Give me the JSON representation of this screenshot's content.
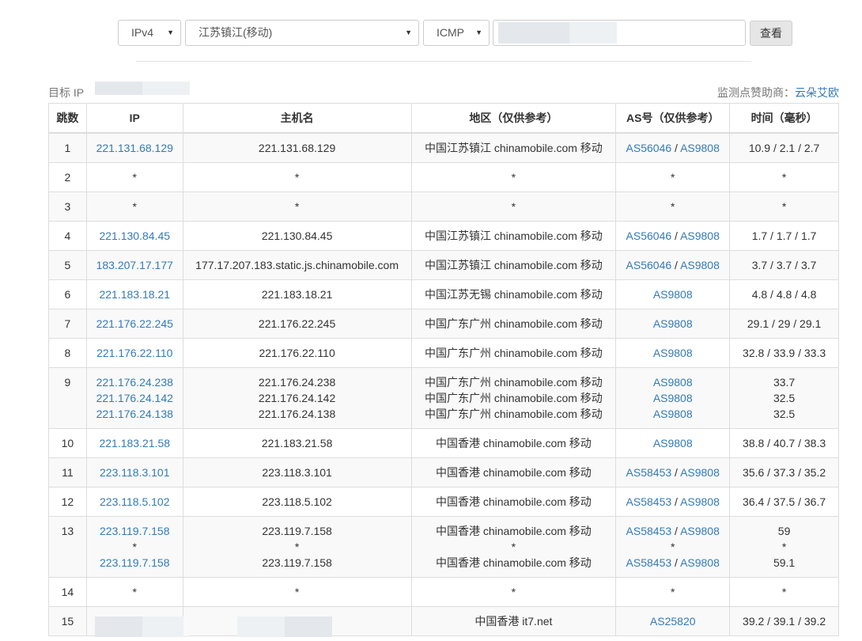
{
  "form": {
    "protocol": {
      "selected": "IPv4"
    },
    "location": {
      "selected": "江苏镇江(移动)"
    },
    "method": {
      "selected": "ICMP"
    },
    "target": {
      "value": ""
    },
    "submit_label": "查看"
  },
  "target_label": "目标 IP",
  "sponsor": {
    "prefix": "监测点赞助商：",
    "name": "云朵艾欧"
  },
  "table": {
    "headers": [
      "跳数",
      "IP",
      "主机名",
      "地区（仅供参考）",
      "AS号（仅供参考）",
      "时间（毫秒）"
    ],
    "rows": [
      {
        "hop": "1",
        "ips": [
          "221.131.68.129"
        ],
        "hosts": [
          "221.131.68.129"
        ],
        "regions": [
          "中国江苏镇江 chinamobile.com 移动"
        ],
        "as": [
          [
            "AS56046",
            "AS9808"
          ]
        ],
        "times": [
          "10.9 / 2.1 / 2.7"
        ]
      },
      {
        "hop": "2",
        "ips": [
          "*"
        ],
        "hosts": [
          "*"
        ],
        "regions": [
          "*"
        ],
        "as": [
          [
            "*"
          ]
        ],
        "times": [
          "*"
        ]
      },
      {
        "hop": "3",
        "ips": [
          "*"
        ],
        "hosts": [
          "*"
        ],
        "regions": [
          "*"
        ],
        "as": [
          [
            "*"
          ]
        ],
        "times": [
          "*"
        ]
      },
      {
        "hop": "4",
        "ips": [
          "221.130.84.45"
        ],
        "hosts": [
          "221.130.84.45"
        ],
        "regions": [
          "中国江苏镇江 chinamobile.com 移动"
        ],
        "as": [
          [
            "AS56046",
            "AS9808"
          ]
        ],
        "times": [
          "1.7 / 1.7 / 1.7"
        ]
      },
      {
        "hop": "5",
        "ips": [
          "183.207.17.177"
        ],
        "hosts": [
          "177.17.207.183.static.js.chinamobile.com"
        ],
        "regions": [
          "中国江苏镇江 chinamobile.com 移动"
        ],
        "as": [
          [
            "AS56046",
            "AS9808"
          ]
        ],
        "times": [
          "3.7 / 3.7 / 3.7"
        ]
      },
      {
        "hop": "6",
        "ips": [
          "221.183.18.21"
        ],
        "hosts": [
          "221.183.18.21"
        ],
        "regions": [
          "中国江苏无锡 chinamobile.com 移动"
        ],
        "as": [
          [
            "AS9808"
          ]
        ],
        "times": [
          "4.8 / 4.8 / 4.8"
        ]
      },
      {
        "hop": "7",
        "ips": [
          "221.176.22.245"
        ],
        "hosts": [
          "221.176.22.245"
        ],
        "regions": [
          "中国广东广州 chinamobile.com 移动"
        ],
        "as": [
          [
            "AS9808"
          ]
        ],
        "times": [
          "29.1 / 29 / 29.1"
        ]
      },
      {
        "hop": "8",
        "ips": [
          "221.176.22.110"
        ],
        "hosts": [
          "221.176.22.110"
        ],
        "regions": [
          "中国广东广州 chinamobile.com 移动"
        ],
        "as": [
          [
            "AS9808"
          ]
        ],
        "times": [
          "32.8 / 33.9 / 33.3"
        ]
      },
      {
        "hop": "9",
        "ips": [
          "221.176.24.238",
          "221.176.24.142",
          "221.176.24.138"
        ],
        "hosts": [
          "221.176.24.238",
          "221.176.24.142",
          "221.176.24.138"
        ],
        "regions": [
          "中国广东广州 chinamobile.com 移动",
          "中国广东广州 chinamobile.com 移动",
          "中国广东广州 chinamobile.com 移动"
        ],
        "as": [
          [
            "AS9808"
          ],
          [
            "AS9808"
          ],
          [
            "AS9808"
          ]
        ],
        "times": [
          "33.7",
          "32.5",
          "32.5"
        ]
      },
      {
        "hop": "10",
        "ips": [
          "221.183.21.58"
        ],
        "hosts": [
          "221.183.21.58"
        ],
        "regions": [
          "中国香港 chinamobile.com 移动"
        ],
        "as": [
          [
            "AS9808"
          ]
        ],
        "times": [
          "38.8 / 40.7 / 38.3"
        ]
      },
      {
        "hop": "11",
        "ips": [
          "223.118.3.101"
        ],
        "hosts": [
          "223.118.3.101"
        ],
        "regions": [
          "中国香港 chinamobile.com 移动"
        ],
        "as": [
          [
            "AS58453",
            "AS9808"
          ]
        ],
        "times": [
          "35.6 / 37.3 / 35.2"
        ]
      },
      {
        "hop": "12",
        "ips": [
          "223.118.5.102"
        ],
        "hosts": [
          "223.118.5.102"
        ],
        "regions": [
          "中国香港 chinamobile.com 移动"
        ],
        "as": [
          [
            "AS58453",
            "AS9808"
          ]
        ],
        "times": [
          "36.4 / 37.5 / 36.7"
        ]
      },
      {
        "hop": "13",
        "ips": [
          "223.119.7.158",
          "*",
          "223.119.7.158"
        ],
        "hosts": [
          "223.119.7.158",
          "*",
          "223.119.7.158"
        ],
        "regions": [
          "中国香港 chinamobile.com 移动",
          "*",
          "中国香港 chinamobile.com 移动"
        ],
        "as": [
          [
            "AS58453",
            "AS9808"
          ],
          [
            "*"
          ],
          [
            "AS58453",
            "AS9808"
          ]
        ],
        "times": [
          "59",
          "*",
          "59.1"
        ]
      },
      {
        "hop": "14",
        "ips": [
          "*"
        ],
        "hosts": [
          "*"
        ],
        "regions": [
          "*"
        ],
        "as": [
          [
            "*"
          ]
        ],
        "times": [
          "*"
        ]
      },
      {
        "hop": "15",
        "ips": [],
        "hosts": [],
        "regions": [
          "中国香港 it7.net"
        ],
        "as": [
          [
            "AS25820"
          ]
        ],
        "times": [
          "39.2 / 39.1 / 39.2"
        ]
      }
    ]
  },
  "colors": {
    "link": "#337ab7",
    "stripe": "#f9f9f9",
    "border": "#dddddd"
  }
}
